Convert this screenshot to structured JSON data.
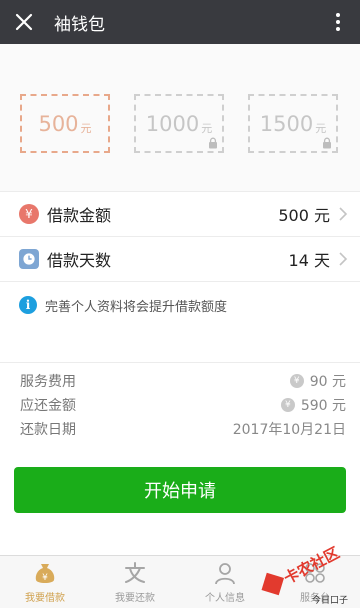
{
  "app": {
    "title": "袖钱包"
  },
  "amount_options": [
    {
      "value": "500",
      "unit": "元",
      "selected": true,
      "locked": false
    },
    {
      "value": "1000",
      "unit": "元",
      "selected": false,
      "locked": true
    },
    {
      "value": "1500",
      "unit": "元",
      "selected": false,
      "locked": true
    }
  ],
  "loan_amount": {
    "label": "借款金额",
    "value": "500 元",
    "icon": "yen-icon",
    "icon_color": "#e8776b"
  },
  "loan_days": {
    "label": "借款天数",
    "value": "14 天",
    "icon": "clock-icon",
    "icon_color": "#7ea6d3"
  },
  "tip": {
    "text": "完善个人资料将会提升借款额度",
    "icon": "info-icon"
  },
  "summary": {
    "fee": {
      "label": "服务费用",
      "value": "90 元"
    },
    "repay_amount": {
      "label": "应还金额",
      "value": "590 元"
    },
    "repay_date": {
      "label": "还款日期",
      "value": "2017年10月21日"
    }
  },
  "submit": {
    "label": "开始申请",
    "color": "#1aad19"
  },
  "tabs": [
    {
      "label": "我要借款",
      "icon": "money-bag-icon",
      "active": true
    },
    {
      "label": "我要还款",
      "icon": "repay-icon",
      "active": false
    },
    {
      "label": "个人信息",
      "icon": "person-icon",
      "active": false
    },
    {
      "label": "服务台",
      "icon": "grid-icon",
      "active": false
    }
  ],
  "watermark": {
    "brand": "卡农社区",
    "source": "今日口子"
  },
  "colors": {
    "appbar": "#393a3f",
    "accent_gold": "#d0a14e",
    "selected_border": "#e8a88a"
  }
}
